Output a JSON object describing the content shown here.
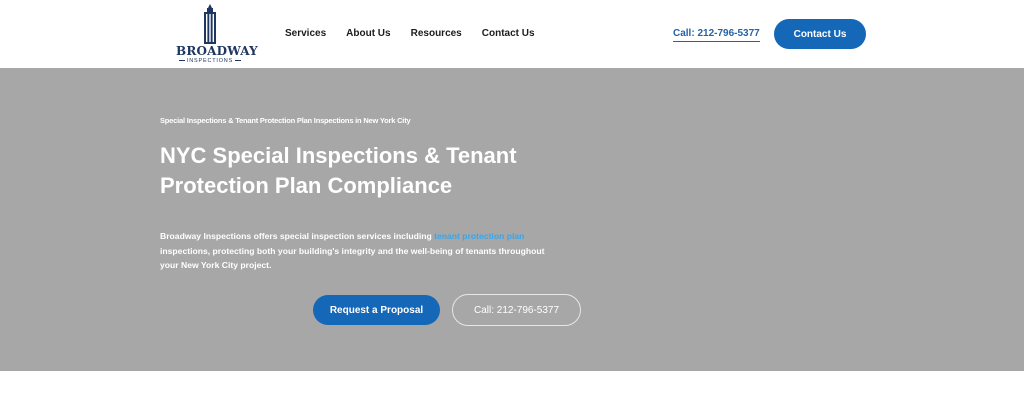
{
  "brand": {
    "name": "BROADWAY",
    "subtitle": "INSPECTIONS",
    "primary_color": "#1567b8",
    "logo_color": "#1f3660"
  },
  "nav": {
    "items": [
      "Services",
      "About Us",
      "Resources",
      "Contact Us"
    ]
  },
  "header": {
    "call_link": "Call: 212-796-5377",
    "contact_button": "Contact Us"
  },
  "hero": {
    "background": "#a7a7a7",
    "eyebrow": "Special Inspections & Tenant Protection Plan Inspections in New York City",
    "headline": "NYC Special Inspections & Tenant Protection Plan Compliance",
    "description_before": "Broadway Inspections offers special inspection services including ",
    "description_link": "tenant protection plan",
    "description_after": " inspections, protecting both your building's integrity and the well-being of tenants throughout your New York City project.",
    "primary_button": "Request a Proposal",
    "secondary_button": "Call: 212-796-5377"
  }
}
